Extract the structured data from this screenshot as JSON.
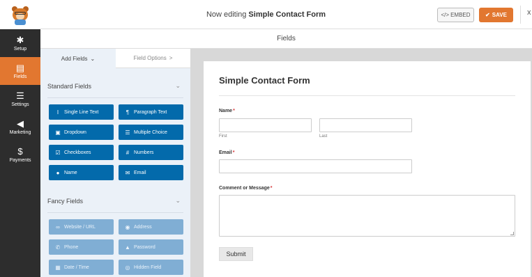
{
  "topbar": {
    "editing_prefix": "Now editing",
    "form_name": "Simple Contact Form",
    "embed_label": "EMBED",
    "save_label": "SAVE",
    "close_glyph": "x",
    "accent_color": "#e27730"
  },
  "sidebar": {
    "items": [
      {
        "label": "Setup",
        "icon": "gear-icon",
        "active": false
      },
      {
        "label": "Fields",
        "icon": "fields-icon",
        "active": true
      },
      {
        "label": "Settings",
        "icon": "sliders-icon",
        "active": false
      },
      {
        "label": "Marketing",
        "icon": "megaphone-icon",
        "active": false
      },
      {
        "label": "Payments",
        "icon": "dollar-icon",
        "active": false
      }
    ]
  },
  "header": {
    "title": "Fields"
  },
  "panel": {
    "tabs": [
      {
        "label": "Add Fields",
        "glyph": "⌄"
      },
      {
        "label": "Field Options",
        "glyph": ">"
      }
    ],
    "standard": {
      "title": "Standard Fields",
      "fields": [
        {
          "label": "Single Line Text",
          "icon": "text-cursor-icon"
        },
        {
          "label": "Paragraph Text",
          "icon": "paragraph-icon"
        },
        {
          "label": "Dropdown",
          "icon": "dropdown-icon"
        },
        {
          "label": "Multiple Choice",
          "icon": "list-icon"
        },
        {
          "label": "Checkboxes",
          "icon": "checkbox-icon"
        },
        {
          "label": "Numbers",
          "icon": "hash-icon"
        },
        {
          "label": "Name",
          "icon": "user-icon"
        },
        {
          "label": "Email",
          "icon": "envelope-icon"
        }
      ]
    },
    "fancy": {
      "title": "Fancy Fields",
      "fields": [
        {
          "label": "Website / URL",
          "icon": "link-icon"
        },
        {
          "label": "Address",
          "icon": "map-pin-icon"
        },
        {
          "label": "Phone",
          "icon": "phone-icon"
        },
        {
          "label": "Password",
          "icon": "lock-icon"
        },
        {
          "label": "Date / Time",
          "icon": "calendar-icon"
        },
        {
          "label": "Hidden Field",
          "icon": "eye-slash-icon"
        }
      ]
    }
  },
  "preview": {
    "title": "Simple Contact Form",
    "name_label": "Name",
    "first_label": "First",
    "last_label": "Last",
    "email_label": "Email",
    "message_label": "Comment or Message",
    "required_mark": "*",
    "submit_label": "Submit"
  }
}
